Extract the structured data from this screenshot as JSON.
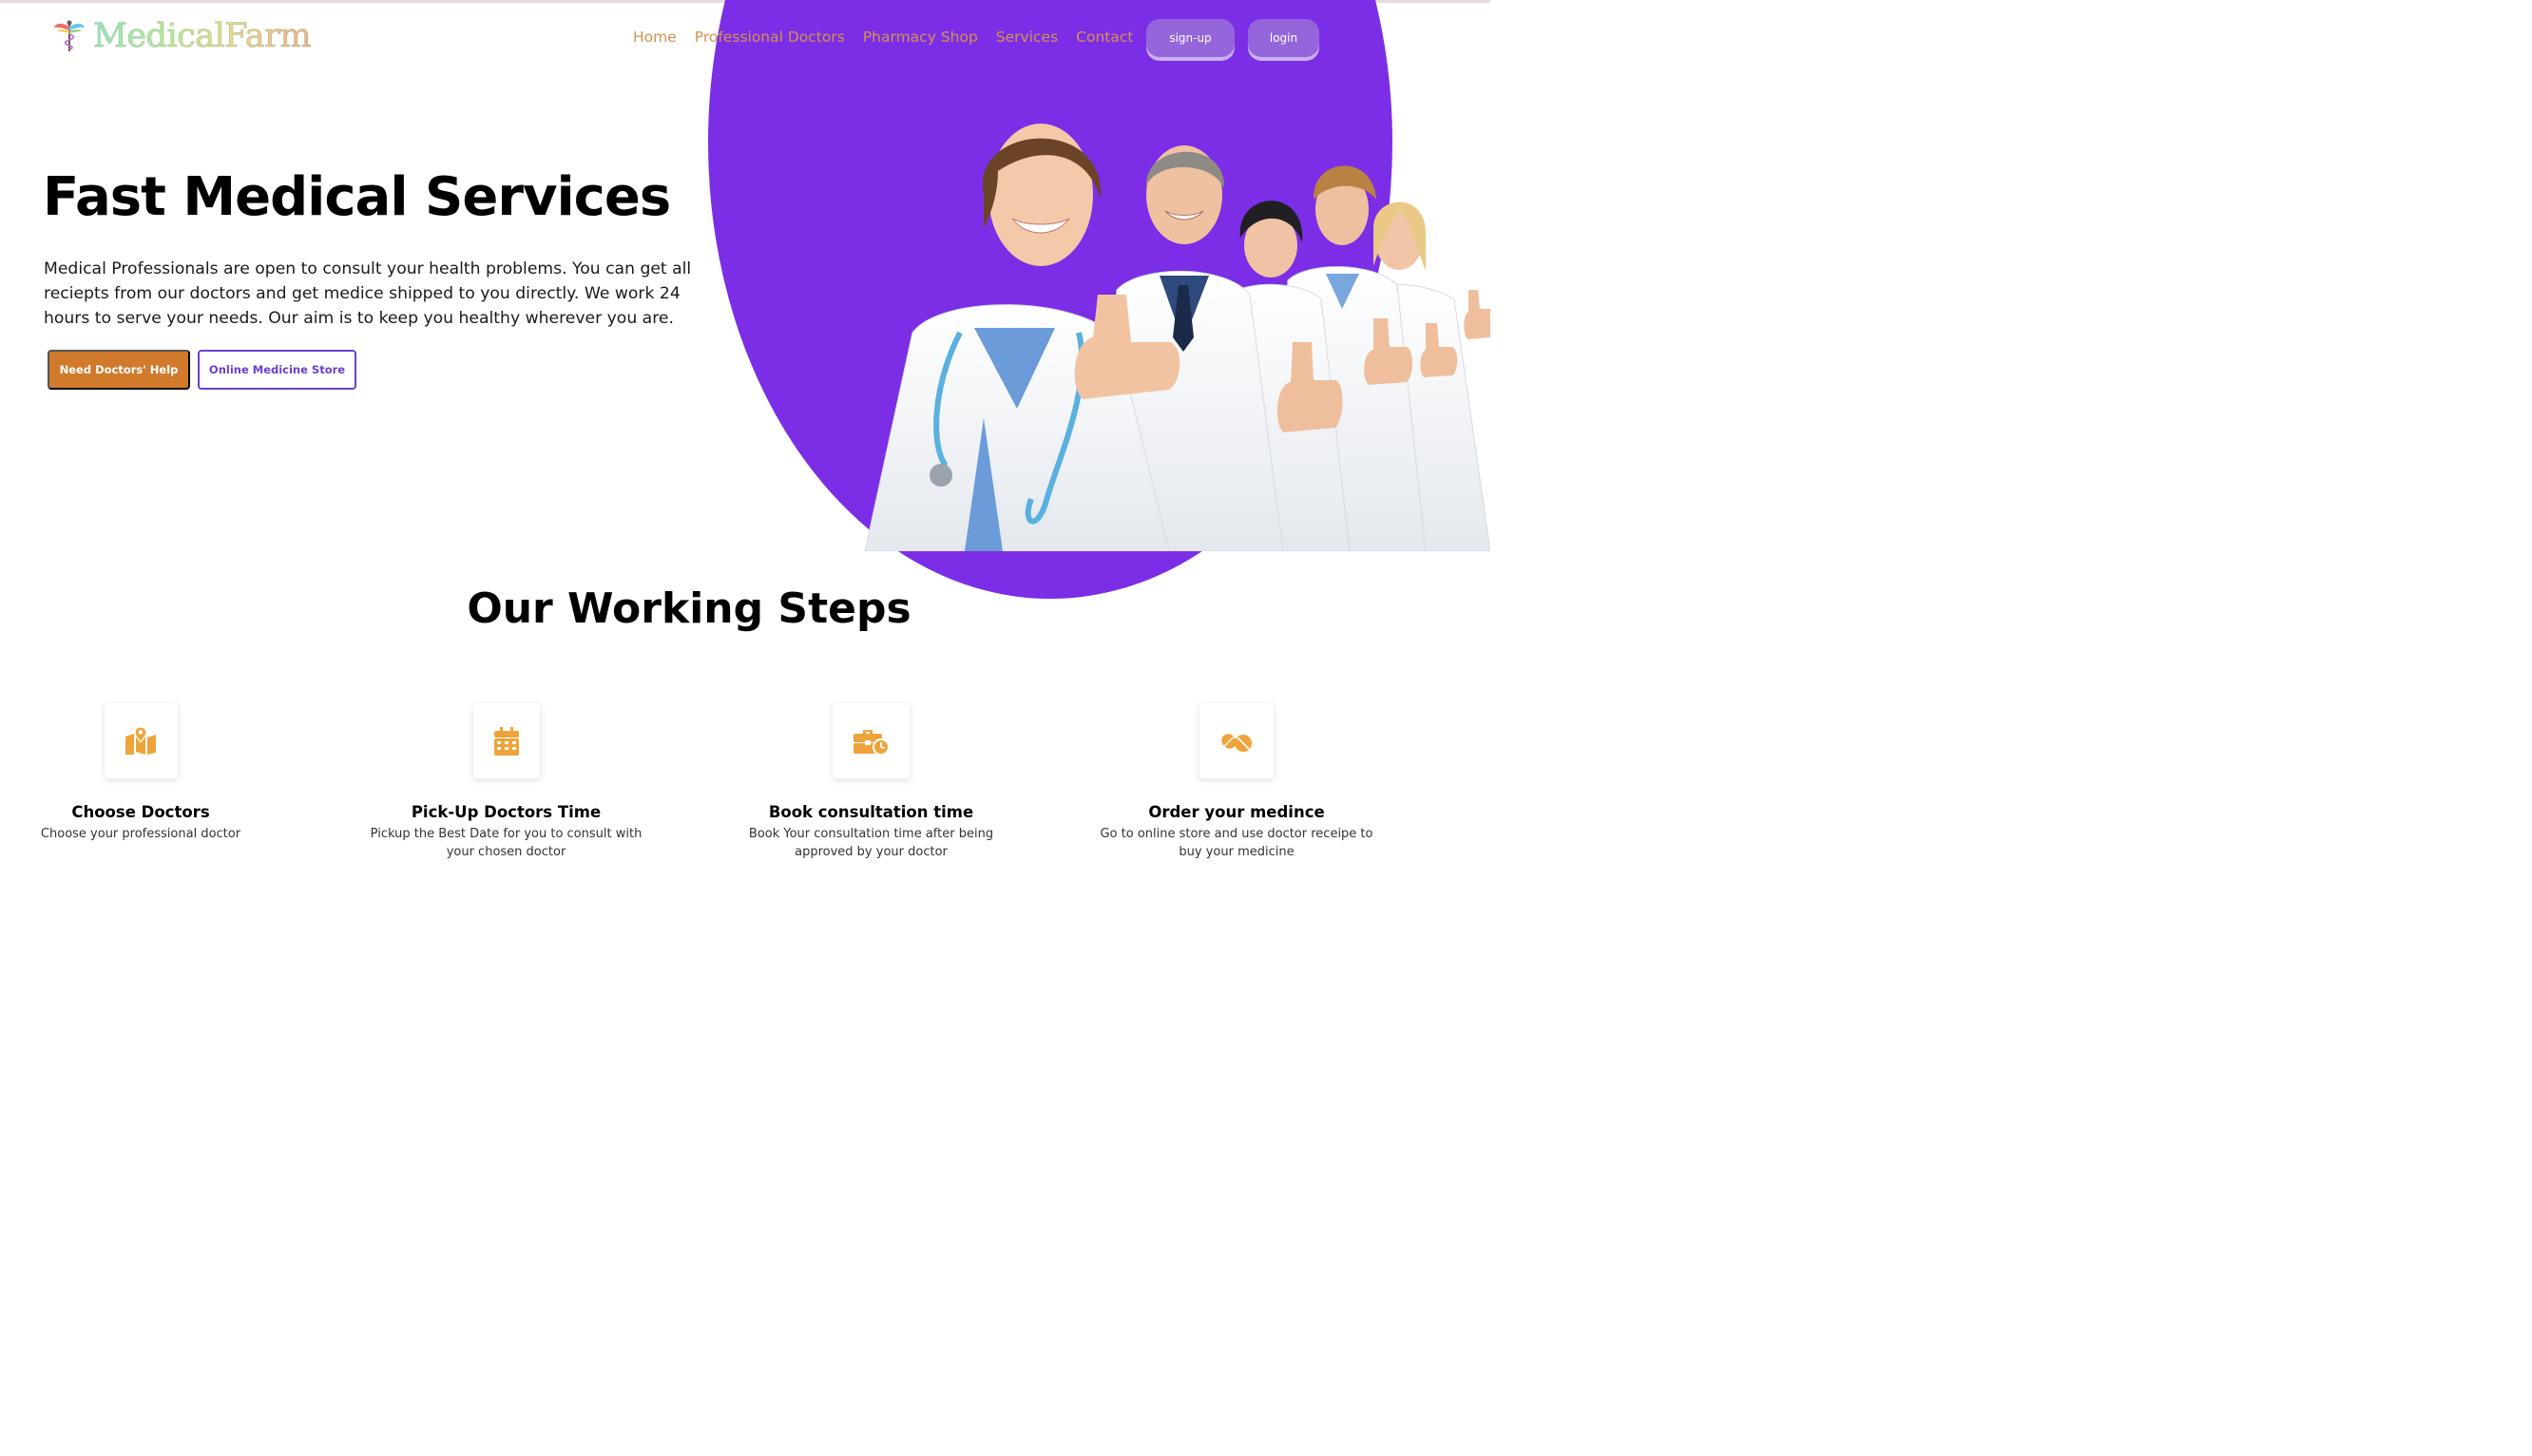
{
  "brand": {
    "name": "MedicalFarm",
    "logo_icon": "caduceus-icon"
  },
  "nav": {
    "items": [
      {
        "label": "Home"
      },
      {
        "label": "Professional Doctors"
      },
      {
        "label": "Pharmacy Shop"
      },
      {
        "label": "Services"
      },
      {
        "label": "Contact"
      }
    ],
    "signup_label": "sign-up",
    "login_label": "login"
  },
  "hero": {
    "title": "Fast Medical Services",
    "description": "Medical Professionals are open to consult your health problems. You can get all reciepts from our doctors and get medice shipped to you directly. We work 24 hours to serve your needs. Our aim is to keep you healthy wherever you are.",
    "primary_button": "Need Doctors' Help",
    "secondary_button": "Online Medicine Store",
    "image": "five-smiling-doctors-thumbs-up"
  },
  "steps": {
    "title": "Our Working Steps",
    "items": [
      {
        "icon": "map-location-icon",
        "title": "Choose Doctors",
        "text": "Choose your professional doctor"
      },
      {
        "icon": "calendar-icon",
        "title": "Pick-Up Doctors Time",
        "text": "Pickup the Best Date for you to consult with your chosen doctor"
      },
      {
        "icon": "briefcase-clock-icon",
        "title": "Book consultation time",
        "text": "Book Your consultation time after being approved by your doctor"
      },
      {
        "icon": "pills-icon",
        "title": "Order your medince",
        "text": "Go to online store and use doctor receipe to buy your medicine"
      }
    ]
  },
  "colors": {
    "accent_purple": "#7b2ee6",
    "button_purple": "#9566db",
    "nav_text": "#d4924e",
    "primary_button": "#d17a2c",
    "icon_orange": "#f0a33a"
  }
}
